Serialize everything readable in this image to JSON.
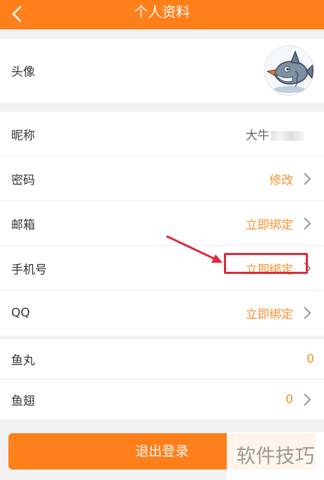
{
  "header": {
    "title": "个人资料",
    "back_icon": "chevron-left-icon",
    "bg_color": "#ff7f1a"
  },
  "profile": {
    "avatar_label": "头像",
    "avatar_icon": "shark-avatar"
  },
  "account": {
    "rows": [
      {
        "label": "昵称",
        "value": "大牛"
      },
      {
        "label": "密码",
        "value": "修改"
      },
      {
        "label": "邮箱",
        "value": "立即绑定"
      },
      {
        "label": "手机号",
        "value": "立即绑定"
      },
      {
        "label": "QQ",
        "value": "立即绑定"
      }
    ]
  },
  "wallet": {
    "rows": [
      {
        "label": "鱼丸",
        "value": "0"
      },
      {
        "label": "鱼翅",
        "value": "0"
      }
    ]
  },
  "logout_label": "退出登录",
  "watermark": "软件技巧",
  "accent_color": "#f5922e",
  "annotation_color": "#e0283a"
}
